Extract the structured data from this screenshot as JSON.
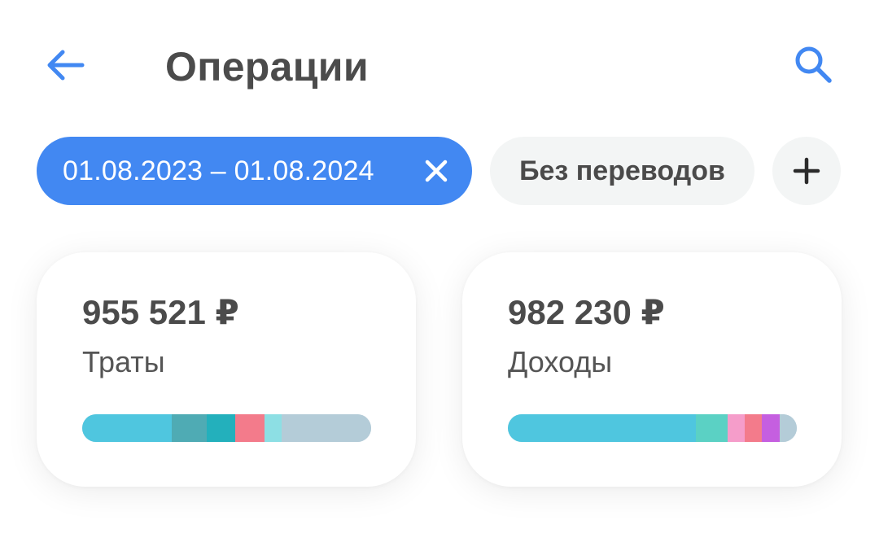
{
  "header": {
    "back_icon": "arrow-left-icon",
    "title": "Операции",
    "search_icon": "search-icon",
    "accent_color": "#4288f2"
  },
  "filters": {
    "date_range": {
      "label": "01.08.2023 – 01.08.2024",
      "close_icon": "close-icon",
      "color": "#4288f2"
    },
    "transfers": {
      "label": "Без переводов"
    },
    "add": {
      "icon": "plus-icon"
    }
  },
  "summary": {
    "spending": {
      "amount": "955 521 ₽",
      "label": "Траты",
      "breakdown": [
        {
          "share": 0.31,
          "color": "#4fc6df"
        },
        {
          "share": 0.12,
          "color": "#4fabb4"
        },
        {
          "share": 0.1,
          "color": "#23b0bc"
        },
        {
          "share": 0.1,
          "color": "#f37b8b"
        },
        {
          "share": 0.06,
          "color": "#8ddfe4"
        },
        {
          "share": 0.31,
          "color": "#b4ccd8"
        }
      ]
    },
    "income": {
      "amount": "982 230 ₽",
      "label": "Доходы",
      "breakdown": [
        {
          "share": 0.65,
          "color": "#4fc6df"
        },
        {
          "share": 0.11,
          "color": "#5bd1c4"
        },
        {
          "share": 0.06,
          "color": "#f59dca"
        },
        {
          "share": 0.06,
          "color": "#f37b8b"
        },
        {
          "share": 0.06,
          "color": "#c55fe0"
        },
        {
          "share": 0.06,
          "color": "#b4ccd8"
        }
      ]
    }
  }
}
